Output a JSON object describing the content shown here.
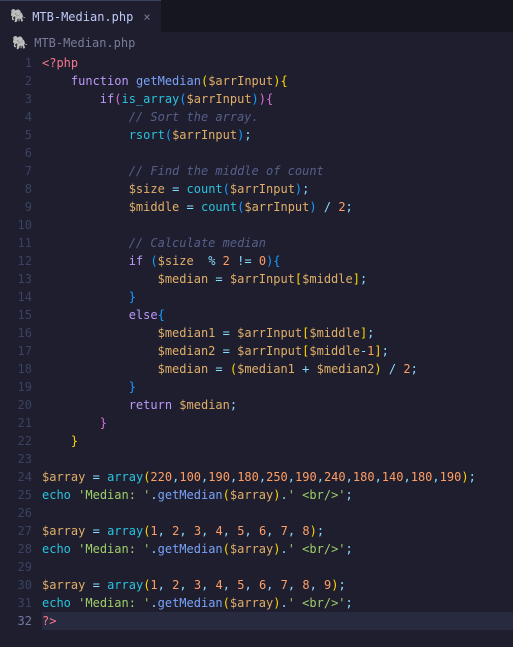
{
  "tab": {
    "filename": "MTB-Median.php",
    "close": "×"
  },
  "breadcrumb": {
    "filename": "MTB-Median.php"
  },
  "icons": {
    "php": "🐘"
  },
  "gutter_active_line": 32,
  "code_lines": [
    {
      "n": 1,
      "indent": 0,
      "tokens": [
        [
          "c-tag",
          "<?php"
        ]
      ]
    },
    {
      "n": 2,
      "indent": 1,
      "tokens": [
        [
          "c-kw",
          "function"
        ],
        [
          "",
          " "
        ],
        [
          "c-fn",
          "getMedian"
        ],
        [
          "c-rainbow1",
          "("
        ],
        [
          "c-var",
          "$arrInput"
        ],
        [
          "c-rainbow1",
          ")"
        ],
        [
          "c-rainbow1",
          "{"
        ]
      ]
    },
    {
      "n": 3,
      "indent": 2,
      "tokens": [
        [
          "c-kw",
          "if"
        ],
        [
          "c-rainbow2",
          "("
        ],
        [
          "c-builtin",
          "is_array"
        ],
        [
          "c-rainbow3",
          "("
        ],
        [
          "c-var",
          "$arrInput"
        ],
        [
          "c-rainbow3",
          ")"
        ],
        [
          "c-rainbow2",
          ")"
        ],
        [
          "c-rainbow2",
          "{"
        ]
      ]
    },
    {
      "n": 4,
      "indent": 3,
      "tokens": [
        [
          "c-com",
          "// Sort the array."
        ]
      ]
    },
    {
      "n": 5,
      "indent": 3,
      "tokens": [
        [
          "c-builtin",
          "rsort"
        ],
        [
          "c-rainbow3",
          "("
        ],
        [
          "c-var",
          "$arrInput"
        ],
        [
          "c-rainbow3",
          ")"
        ],
        [
          "c-punc",
          ";"
        ]
      ]
    },
    {
      "n": 6,
      "indent": 0,
      "tokens": []
    },
    {
      "n": 7,
      "indent": 3,
      "tokens": [
        [
          "c-com",
          "// Find the middle of count"
        ]
      ]
    },
    {
      "n": 8,
      "indent": 3,
      "tokens": [
        [
          "c-var",
          "$size"
        ],
        [
          "",
          " "
        ],
        [
          "c-op",
          "="
        ],
        [
          "",
          " "
        ],
        [
          "c-builtin",
          "count"
        ],
        [
          "c-rainbow3",
          "("
        ],
        [
          "c-var",
          "$arrInput"
        ],
        [
          "c-rainbow3",
          ")"
        ],
        [
          "c-punc",
          ";"
        ]
      ]
    },
    {
      "n": 9,
      "indent": 3,
      "tokens": [
        [
          "c-var",
          "$middle"
        ],
        [
          "",
          " "
        ],
        [
          "c-op",
          "="
        ],
        [
          "",
          " "
        ],
        [
          "c-builtin",
          "count"
        ],
        [
          "c-rainbow3",
          "("
        ],
        [
          "c-var",
          "$arrInput"
        ],
        [
          "c-rainbow3",
          ")"
        ],
        [
          "",
          " "
        ],
        [
          "c-op",
          "/"
        ],
        [
          "",
          " "
        ],
        [
          "c-num",
          "2"
        ],
        [
          "c-punc",
          ";"
        ]
      ]
    },
    {
      "n": 10,
      "indent": 0,
      "tokens": []
    },
    {
      "n": 11,
      "indent": 3,
      "tokens": [
        [
          "c-com",
          "// Calculate median"
        ]
      ]
    },
    {
      "n": 12,
      "indent": 3,
      "tokens": [
        [
          "c-kw",
          "if"
        ],
        [
          "",
          " "
        ],
        [
          "c-rainbow3",
          "("
        ],
        [
          "c-var",
          "$size"
        ],
        [
          "",
          "  "
        ],
        [
          "c-op",
          "%"
        ],
        [
          "",
          " "
        ],
        [
          "c-num",
          "2"
        ],
        [
          "",
          " "
        ],
        [
          "c-op",
          "!="
        ],
        [
          "",
          " "
        ],
        [
          "c-num",
          "0"
        ],
        [
          "c-rainbow3",
          ")"
        ],
        [
          "c-rainbow3",
          "{"
        ]
      ]
    },
    {
      "n": 13,
      "indent": 4,
      "tokens": [
        [
          "c-var",
          "$median"
        ],
        [
          "",
          " "
        ],
        [
          "c-op",
          "="
        ],
        [
          "",
          " "
        ],
        [
          "c-var",
          "$arrInput"
        ],
        [
          "c-rainbow1",
          "["
        ],
        [
          "c-var",
          "$middle"
        ],
        [
          "c-rainbow1",
          "]"
        ],
        [
          "c-punc",
          ";"
        ]
      ]
    },
    {
      "n": 14,
      "indent": 3,
      "tokens": [
        [
          "c-rainbow3",
          "}"
        ]
      ]
    },
    {
      "n": 15,
      "indent": 3,
      "tokens": [
        [
          "c-kw",
          "else"
        ],
        [
          "c-rainbow3",
          "{"
        ]
      ]
    },
    {
      "n": 16,
      "indent": 4,
      "tokens": [
        [
          "c-var",
          "$median1"
        ],
        [
          "",
          " "
        ],
        [
          "c-op",
          "="
        ],
        [
          "",
          " "
        ],
        [
          "c-var",
          "$arrInput"
        ],
        [
          "c-rainbow1",
          "["
        ],
        [
          "c-var",
          "$middle"
        ],
        [
          "c-rainbow1",
          "]"
        ],
        [
          "c-punc",
          ";"
        ]
      ]
    },
    {
      "n": 17,
      "indent": 4,
      "tokens": [
        [
          "c-var",
          "$median2"
        ],
        [
          "",
          " "
        ],
        [
          "c-op",
          "="
        ],
        [
          "",
          " "
        ],
        [
          "c-var",
          "$arrInput"
        ],
        [
          "c-rainbow1",
          "["
        ],
        [
          "c-var",
          "$middle"
        ],
        [
          "c-op",
          "-"
        ],
        [
          "c-num",
          "1"
        ],
        [
          "c-rainbow1",
          "]"
        ],
        [
          "c-punc",
          ";"
        ]
      ]
    },
    {
      "n": 18,
      "indent": 4,
      "tokens": [
        [
          "c-var",
          "$median"
        ],
        [
          "",
          " "
        ],
        [
          "c-op",
          "="
        ],
        [
          "",
          " "
        ],
        [
          "c-rainbow1",
          "("
        ],
        [
          "c-var",
          "$median1"
        ],
        [
          "",
          " "
        ],
        [
          "c-op",
          "+"
        ],
        [
          "",
          " "
        ],
        [
          "c-var",
          "$median2"
        ],
        [
          "c-rainbow1",
          ")"
        ],
        [
          "",
          " "
        ],
        [
          "c-op",
          "/"
        ],
        [
          "",
          " "
        ],
        [
          "c-num",
          "2"
        ],
        [
          "c-punc",
          ";"
        ]
      ]
    },
    {
      "n": 19,
      "indent": 3,
      "tokens": [
        [
          "c-rainbow3",
          "}"
        ]
      ]
    },
    {
      "n": 20,
      "indent": 3,
      "tokens": [
        [
          "c-kw",
          "return"
        ],
        [
          "",
          " "
        ],
        [
          "c-var",
          "$median"
        ],
        [
          "c-punc",
          ";"
        ]
      ]
    },
    {
      "n": 21,
      "indent": 2,
      "tokens": [
        [
          "c-rainbow2",
          "}"
        ]
      ]
    },
    {
      "n": 22,
      "indent": 1,
      "tokens": [
        [
          "c-rainbow1",
          "}"
        ]
      ]
    },
    {
      "n": 23,
      "indent": 0,
      "tokens": []
    },
    {
      "n": 24,
      "indent": 0,
      "tokens": [
        [
          "c-var",
          "$array"
        ],
        [
          "",
          " "
        ],
        [
          "c-op",
          "="
        ],
        [
          "",
          " "
        ],
        [
          "c-builtin",
          "array"
        ],
        [
          "c-rainbow1",
          "("
        ],
        [
          "c-num",
          "220"
        ],
        [
          "c-punc",
          ","
        ],
        [
          "c-num",
          "100"
        ],
        [
          "c-punc",
          ","
        ],
        [
          "c-num",
          "190"
        ],
        [
          "c-punc",
          ","
        ],
        [
          "c-num",
          "180"
        ],
        [
          "c-punc",
          ","
        ],
        [
          "c-num",
          "250"
        ],
        [
          "c-punc",
          ","
        ],
        [
          "c-num",
          "190"
        ],
        [
          "c-punc",
          ","
        ],
        [
          "c-num",
          "240"
        ],
        [
          "c-punc",
          ","
        ],
        [
          "c-num",
          "180"
        ],
        [
          "c-punc",
          ","
        ],
        [
          "c-num",
          "140"
        ],
        [
          "c-punc",
          ","
        ],
        [
          "c-num",
          "180"
        ],
        [
          "c-punc",
          ","
        ],
        [
          "c-num",
          "190"
        ],
        [
          "c-rainbow1",
          ")"
        ],
        [
          "c-punc",
          ";"
        ]
      ]
    },
    {
      "n": 25,
      "indent": 0,
      "tokens": [
        [
          "c-builtin",
          "echo"
        ],
        [
          "",
          " "
        ],
        [
          "c-str",
          "'Median: '"
        ],
        [
          "c-op",
          "."
        ],
        [
          "c-fn",
          "getMedian"
        ],
        [
          "c-rainbow1",
          "("
        ],
        [
          "c-var",
          "$array"
        ],
        [
          "c-rainbow1",
          ")"
        ],
        [
          "c-op",
          "."
        ],
        [
          "c-str",
          "' <br/>'"
        ],
        [
          "c-punc",
          ";"
        ]
      ]
    },
    {
      "n": 26,
      "indent": 0,
      "tokens": []
    },
    {
      "n": 27,
      "indent": 0,
      "tokens": [
        [
          "c-var",
          "$array"
        ],
        [
          "",
          " "
        ],
        [
          "c-op",
          "="
        ],
        [
          "",
          " "
        ],
        [
          "c-builtin",
          "array"
        ],
        [
          "c-rainbow1",
          "("
        ],
        [
          "c-num",
          "1"
        ],
        [
          "c-punc",
          ","
        ],
        [
          "",
          " "
        ],
        [
          "c-num",
          "2"
        ],
        [
          "c-punc",
          ","
        ],
        [
          "",
          " "
        ],
        [
          "c-num",
          "3"
        ],
        [
          "c-punc",
          ","
        ],
        [
          "",
          " "
        ],
        [
          "c-num",
          "4"
        ],
        [
          "c-punc",
          ","
        ],
        [
          "",
          " "
        ],
        [
          "c-num",
          "5"
        ],
        [
          "c-punc",
          ","
        ],
        [
          "",
          " "
        ],
        [
          "c-num",
          "6"
        ],
        [
          "c-punc",
          ","
        ],
        [
          "",
          " "
        ],
        [
          "c-num",
          "7"
        ],
        [
          "c-punc",
          ","
        ],
        [
          "",
          " "
        ],
        [
          "c-num",
          "8"
        ],
        [
          "c-rainbow1",
          ")"
        ],
        [
          "c-punc",
          ";"
        ]
      ]
    },
    {
      "n": 28,
      "indent": 0,
      "tokens": [
        [
          "c-builtin",
          "echo"
        ],
        [
          "",
          " "
        ],
        [
          "c-str",
          "'Median: '"
        ],
        [
          "c-op",
          "."
        ],
        [
          "c-fn",
          "getMedian"
        ],
        [
          "c-rainbow1",
          "("
        ],
        [
          "c-var",
          "$array"
        ],
        [
          "c-rainbow1",
          ")"
        ],
        [
          "c-op",
          "."
        ],
        [
          "c-str",
          "' <br/>'"
        ],
        [
          "c-punc",
          ";"
        ]
      ]
    },
    {
      "n": 29,
      "indent": 0,
      "tokens": []
    },
    {
      "n": 30,
      "indent": 0,
      "tokens": [
        [
          "c-var",
          "$array"
        ],
        [
          "",
          " "
        ],
        [
          "c-op",
          "="
        ],
        [
          "",
          " "
        ],
        [
          "c-builtin",
          "array"
        ],
        [
          "c-rainbow1",
          "("
        ],
        [
          "c-num",
          "1"
        ],
        [
          "c-punc",
          ","
        ],
        [
          "",
          " "
        ],
        [
          "c-num",
          "2"
        ],
        [
          "c-punc",
          ","
        ],
        [
          "",
          " "
        ],
        [
          "c-num",
          "3"
        ],
        [
          "c-punc",
          ","
        ],
        [
          "",
          " "
        ],
        [
          "c-num",
          "4"
        ],
        [
          "c-punc",
          ","
        ],
        [
          "",
          " "
        ],
        [
          "c-num",
          "5"
        ],
        [
          "c-punc",
          ","
        ],
        [
          "",
          " "
        ],
        [
          "c-num",
          "6"
        ],
        [
          "c-punc",
          ","
        ],
        [
          "",
          " "
        ],
        [
          "c-num",
          "7"
        ],
        [
          "c-punc",
          ","
        ],
        [
          "",
          " "
        ],
        [
          "c-num",
          "8"
        ],
        [
          "c-punc",
          ","
        ],
        [
          "",
          " "
        ],
        [
          "c-num",
          "9"
        ],
        [
          "c-rainbow1",
          ")"
        ],
        [
          "c-punc",
          ";"
        ]
      ]
    },
    {
      "n": 31,
      "indent": 0,
      "tokens": [
        [
          "c-builtin",
          "echo"
        ],
        [
          "",
          " "
        ],
        [
          "c-str",
          "'Median: '"
        ],
        [
          "c-op",
          "."
        ],
        [
          "c-fn",
          "getMedian"
        ],
        [
          "c-rainbow1",
          "("
        ],
        [
          "c-var",
          "$array"
        ],
        [
          "c-rainbow1",
          ")"
        ],
        [
          "c-op",
          "."
        ],
        [
          "c-str",
          "' <br/>'"
        ],
        [
          "c-punc",
          ";"
        ]
      ]
    },
    {
      "n": 32,
      "indent": 0,
      "tokens": [
        [
          "c-tag",
          "?>"
        ]
      ]
    }
  ]
}
